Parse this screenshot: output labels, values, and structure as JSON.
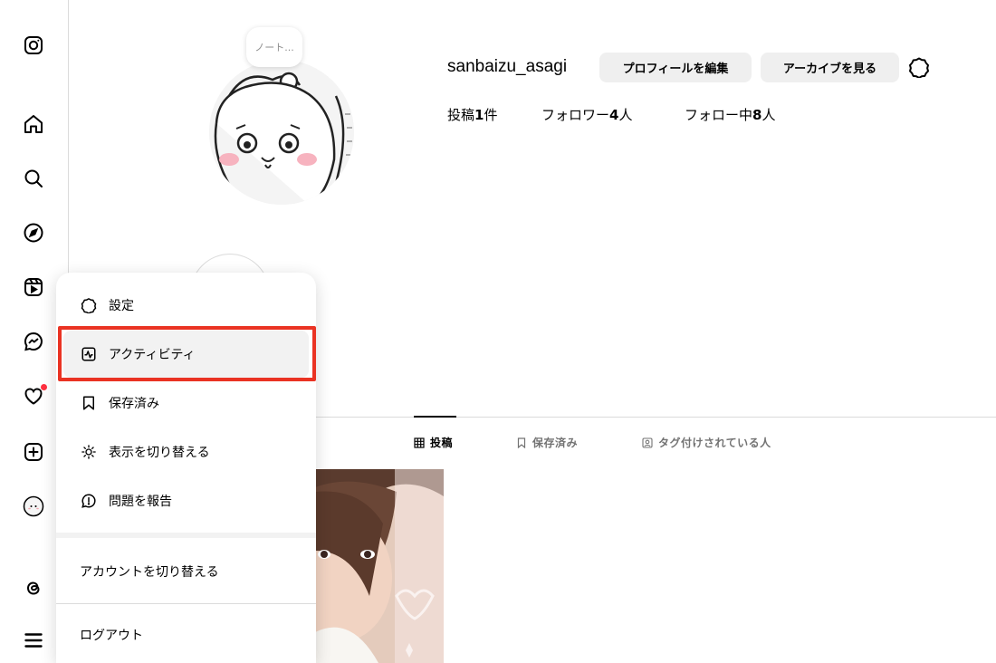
{
  "sidebar": {
    "items": [
      {
        "name": "instagram-logo-icon"
      },
      {
        "name": "home-icon"
      },
      {
        "name": "search-icon"
      },
      {
        "name": "explore-icon"
      },
      {
        "name": "reels-icon"
      },
      {
        "name": "messenger-icon"
      },
      {
        "name": "notifications-heart-icon"
      },
      {
        "name": "create-plus-icon"
      },
      {
        "name": "profile-avatar-icon"
      },
      {
        "name": "threads-icon"
      },
      {
        "name": "more-menu-icon"
      }
    ]
  },
  "profile": {
    "note": "ノート...",
    "username": "sanbaizu_asagi",
    "edit_profile_label": "プロフィールを編集",
    "view_archive_label": "アーカイブを見る",
    "stats": {
      "posts_label": "投稿",
      "posts_count": "1",
      "posts_unit": "件",
      "followers_label": "フォロワー",
      "followers_count": "4",
      "followers_unit": "人",
      "following_label": "フォロー中",
      "following_count": "8",
      "following_unit": "人"
    }
  },
  "tabs": [
    {
      "label": "投稿",
      "icon": "grid-icon",
      "active": true
    },
    {
      "label": "保存済み",
      "icon": "bookmark-icon",
      "active": false
    },
    {
      "label": "タグ付けされている人",
      "icon": "tagged-person-icon",
      "active": false
    }
  ],
  "menu": {
    "items": [
      {
        "label": "設定",
        "icon": "settings-gear-icon"
      },
      {
        "label": "アクティビティ",
        "icon": "activity-icon",
        "highlighted": true
      },
      {
        "label": "保存済み",
        "icon": "bookmark-icon"
      },
      {
        "label": "表示を切り替える",
        "icon": "sun-icon"
      },
      {
        "label": "問題を報告",
        "icon": "report-problem-icon"
      }
    ],
    "switch_account_label": "アカウントを切り替える",
    "logout_label": "ログアウト"
  },
  "colors": {
    "highlight_border": "#ea3323",
    "notification_dot": "#ff3040",
    "button_bg": "#efefef",
    "divider": "#dbdbdb"
  }
}
